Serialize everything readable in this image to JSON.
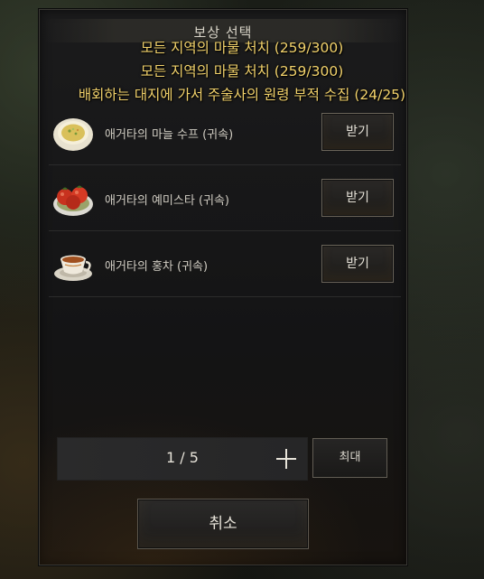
{
  "dialog": {
    "title": "보상 선택"
  },
  "quest_notices": [
    "모든 지역의 마물 처치 (259/300)",
    "모든 지역의 마물 처치 (259/300)",
    "배회하는 대지에 가서 주술사의 원령 부적 수집 (24/25)"
  ],
  "rewards": [
    {
      "name": "애거타의 마늘 수프 (귀속)",
      "button": "받기",
      "icon": "soup-icon"
    },
    {
      "name": "애거타의 예미스타 (귀속)",
      "button": "받기",
      "icon": "tomato-dish-icon"
    },
    {
      "name": "애거타의 홍차 (귀속)",
      "button": "받기",
      "icon": "tea-cup-icon"
    }
  ],
  "quantity": {
    "value": "1 / 5",
    "max_label": "최대",
    "plus_icon": "plus-icon"
  },
  "cancel_label": "취소",
  "colors": {
    "quest_text": "#f2d26b",
    "panel_bg": "#161617",
    "button_border": "#6b655a"
  }
}
